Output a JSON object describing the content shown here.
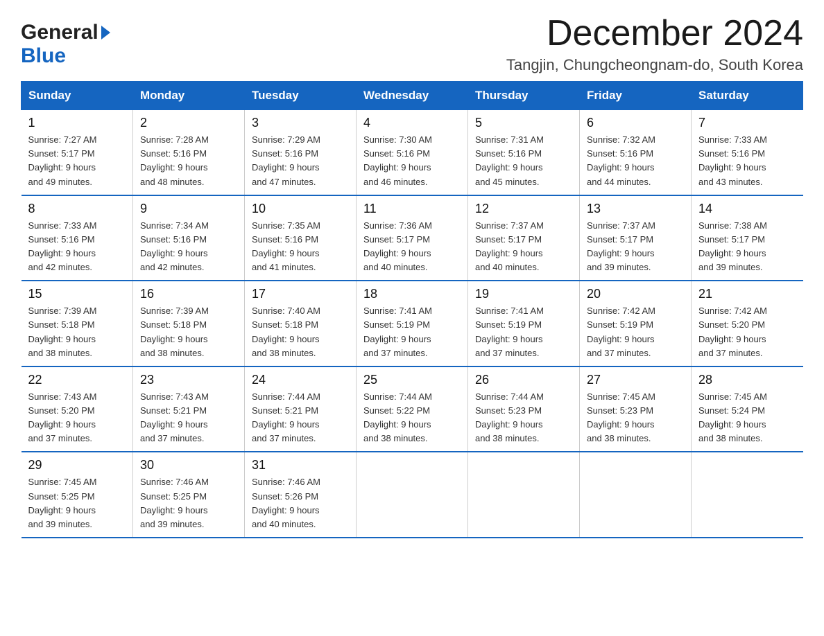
{
  "header": {
    "title": "December 2024",
    "subtitle": "Tangjin, Chungcheongnam-do, South Korea",
    "logo_general": "General",
    "logo_blue": "Blue"
  },
  "days_of_week": [
    "Sunday",
    "Monday",
    "Tuesday",
    "Wednesday",
    "Thursday",
    "Friday",
    "Saturday"
  ],
  "weeks": [
    [
      {
        "date": "1",
        "sunrise": "Sunrise: 7:27 AM",
        "sunset": "Sunset: 5:17 PM",
        "daylight": "Daylight: 9 hours",
        "daylight2": "and 49 minutes."
      },
      {
        "date": "2",
        "sunrise": "Sunrise: 7:28 AM",
        "sunset": "Sunset: 5:16 PM",
        "daylight": "Daylight: 9 hours",
        "daylight2": "and 48 minutes."
      },
      {
        "date": "3",
        "sunrise": "Sunrise: 7:29 AM",
        "sunset": "Sunset: 5:16 PM",
        "daylight": "Daylight: 9 hours",
        "daylight2": "and 47 minutes."
      },
      {
        "date": "4",
        "sunrise": "Sunrise: 7:30 AM",
        "sunset": "Sunset: 5:16 PM",
        "daylight": "Daylight: 9 hours",
        "daylight2": "and 46 minutes."
      },
      {
        "date": "5",
        "sunrise": "Sunrise: 7:31 AM",
        "sunset": "Sunset: 5:16 PM",
        "daylight": "Daylight: 9 hours",
        "daylight2": "and 45 minutes."
      },
      {
        "date": "6",
        "sunrise": "Sunrise: 7:32 AM",
        "sunset": "Sunset: 5:16 PM",
        "daylight": "Daylight: 9 hours",
        "daylight2": "and 44 minutes."
      },
      {
        "date": "7",
        "sunrise": "Sunrise: 7:33 AM",
        "sunset": "Sunset: 5:16 PM",
        "daylight": "Daylight: 9 hours",
        "daylight2": "and 43 minutes."
      }
    ],
    [
      {
        "date": "8",
        "sunrise": "Sunrise: 7:33 AM",
        "sunset": "Sunset: 5:16 PM",
        "daylight": "Daylight: 9 hours",
        "daylight2": "and 42 minutes."
      },
      {
        "date": "9",
        "sunrise": "Sunrise: 7:34 AM",
        "sunset": "Sunset: 5:16 PM",
        "daylight": "Daylight: 9 hours",
        "daylight2": "and 42 minutes."
      },
      {
        "date": "10",
        "sunrise": "Sunrise: 7:35 AM",
        "sunset": "Sunset: 5:16 PM",
        "daylight": "Daylight: 9 hours",
        "daylight2": "and 41 minutes."
      },
      {
        "date": "11",
        "sunrise": "Sunrise: 7:36 AM",
        "sunset": "Sunset: 5:17 PM",
        "daylight": "Daylight: 9 hours",
        "daylight2": "and 40 minutes."
      },
      {
        "date": "12",
        "sunrise": "Sunrise: 7:37 AM",
        "sunset": "Sunset: 5:17 PM",
        "daylight": "Daylight: 9 hours",
        "daylight2": "and 40 minutes."
      },
      {
        "date": "13",
        "sunrise": "Sunrise: 7:37 AM",
        "sunset": "Sunset: 5:17 PM",
        "daylight": "Daylight: 9 hours",
        "daylight2": "and 39 minutes."
      },
      {
        "date": "14",
        "sunrise": "Sunrise: 7:38 AM",
        "sunset": "Sunset: 5:17 PM",
        "daylight": "Daylight: 9 hours",
        "daylight2": "and 39 minutes."
      }
    ],
    [
      {
        "date": "15",
        "sunrise": "Sunrise: 7:39 AM",
        "sunset": "Sunset: 5:18 PM",
        "daylight": "Daylight: 9 hours",
        "daylight2": "and 38 minutes."
      },
      {
        "date": "16",
        "sunrise": "Sunrise: 7:39 AM",
        "sunset": "Sunset: 5:18 PM",
        "daylight": "Daylight: 9 hours",
        "daylight2": "and 38 minutes."
      },
      {
        "date": "17",
        "sunrise": "Sunrise: 7:40 AM",
        "sunset": "Sunset: 5:18 PM",
        "daylight": "Daylight: 9 hours",
        "daylight2": "and 38 minutes."
      },
      {
        "date": "18",
        "sunrise": "Sunrise: 7:41 AM",
        "sunset": "Sunset: 5:19 PM",
        "daylight": "Daylight: 9 hours",
        "daylight2": "and 37 minutes."
      },
      {
        "date": "19",
        "sunrise": "Sunrise: 7:41 AM",
        "sunset": "Sunset: 5:19 PM",
        "daylight": "Daylight: 9 hours",
        "daylight2": "and 37 minutes."
      },
      {
        "date": "20",
        "sunrise": "Sunrise: 7:42 AM",
        "sunset": "Sunset: 5:19 PM",
        "daylight": "Daylight: 9 hours",
        "daylight2": "and 37 minutes."
      },
      {
        "date": "21",
        "sunrise": "Sunrise: 7:42 AM",
        "sunset": "Sunset: 5:20 PM",
        "daylight": "Daylight: 9 hours",
        "daylight2": "and 37 minutes."
      }
    ],
    [
      {
        "date": "22",
        "sunrise": "Sunrise: 7:43 AM",
        "sunset": "Sunset: 5:20 PM",
        "daylight": "Daylight: 9 hours",
        "daylight2": "and 37 minutes."
      },
      {
        "date": "23",
        "sunrise": "Sunrise: 7:43 AM",
        "sunset": "Sunset: 5:21 PM",
        "daylight": "Daylight: 9 hours",
        "daylight2": "and 37 minutes."
      },
      {
        "date": "24",
        "sunrise": "Sunrise: 7:44 AM",
        "sunset": "Sunset: 5:21 PM",
        "daylight": "Daylight: 9 hours",
        "daylight2": "and 37 minutes."
      },
      {
        "date": "25",
        "sunrise": "Sunrise: 7:44 AM",
        "sunset": "Sunset: 5:22 PM",
        "daylight": "Daylight: 9 hours",
        "daylight2": "and 38 minutes."
      },
      {
        "date": "26",
        "sunrise": "Sunrise: 7:44 AM",
        "sunset": "Sunset: 5:23 PM",
        "daylight": "Daylight: 9 hours",
        "daylight2": "and 38 minutes."
      },
      {
        "date": "27",
        "sunrise": "Sunrise: 7:45 AM",
        "sunset": "Sunset: 5:23 PM",
        "daylight": "Daylight: 9 hours",
        "daylight2": "and 38 minutes."
      },
      {
        "date": "28",
        "sunrise": "Sunrise: 7:45 AM",
        "sunset": "Sunset: 5:24 PM",
        "daylight": "Daylight: 9 hours",
        "daylight2": "and 38 minutes."
      }
    ],
    [
      {
        "date": "29",
        "sunrise": "Sunrise: 7:45 AM",
        "sunset": "Sunset: 5:25 PM",
        "daylight": "Daylight: 9 hours",
        "daylight2": "and 39 minutes."
      },
      {
        "date": "30",
        "sunrise": "Sunrise: 7:46 AM",
        "sunset": "Sunset: 5:25 PM",
        "daylight": "Daylight: 9 hours",
        "daylight2": "and 39 minutes."
      },
      {
        "date": "31",
        "sunrise": "Sunrise: 7:46 AM",
        "sunset": "Sunset: 5:26 PM",
        "daylight": "Daylight: 9 hours",
        "daylight2": "and 40 minutes."
      },
      null,
      null,
      null,
      null
    ]
  ]
}
